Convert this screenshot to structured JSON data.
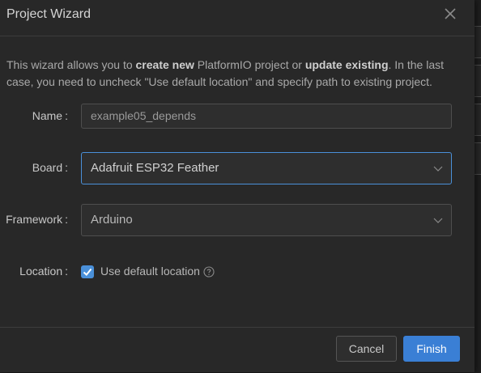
{
  "dialog": {
    "title": "Project Wizard",
    "intro": {
      "part1": "This wizard allows you to ",
      "bold1": "create new",
      "part2": " PlatformIO project or ",
      "bold2": "update existing",
      "part3": ". In the last case, you need to uncheck \"Use default location\" and specify path to existing project."
    }
  },
  "form": {
    "name": {
      "label": "Name",
      "value": "example05_depends"
    },
    "board": {
      "label": "Board",
      "selected": "Adafruit ESP32 Feather"
    },
    "framework": {
      "label": "Framework",
      "selected": "Arduino"
    },
    "location": {
      "label": "Location",
      "checkbox_label": "Use default location",
      "checked": true
    }
  },
  "footer": {
    "cancel_label": "Cancel",
    "finish_label": "Finish"
  },
  "colors": {
    "accent": "#3a7fd5",
    "background": "#282828"
  }
}
